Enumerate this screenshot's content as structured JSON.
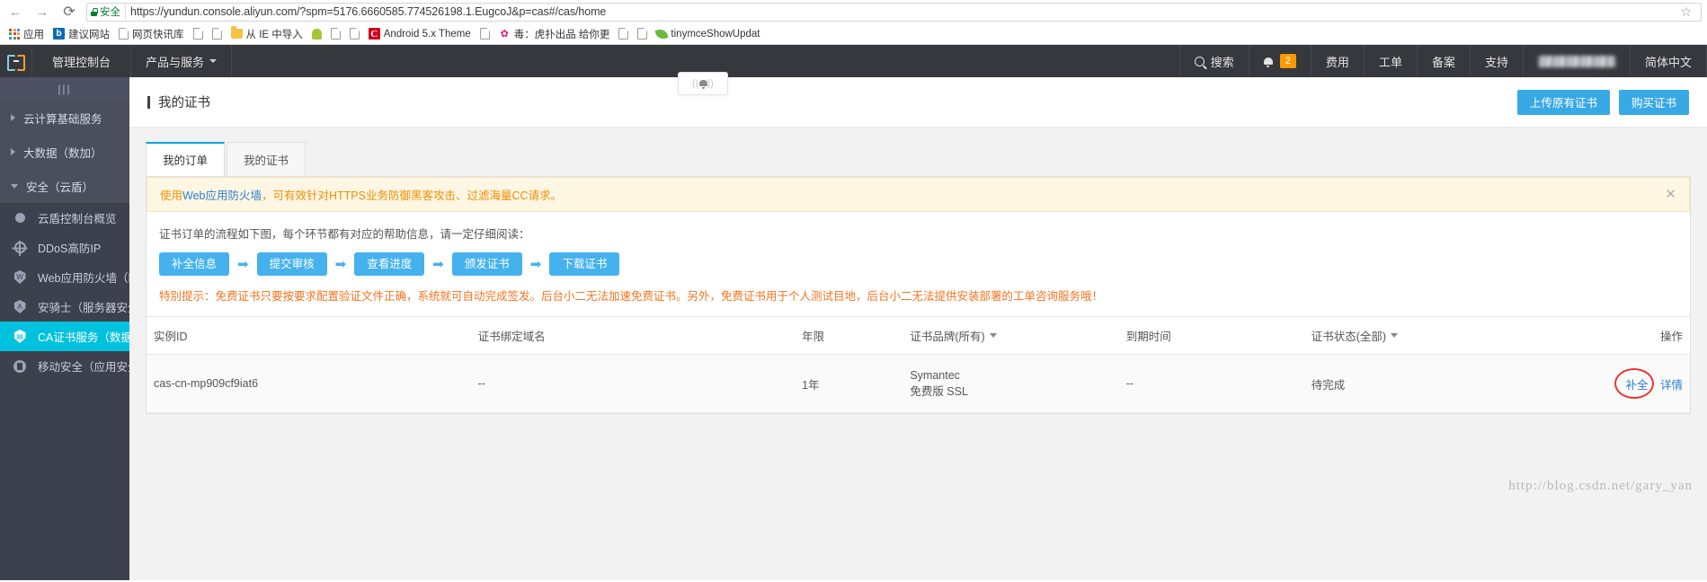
{
  "browser": {
    "back_icon": "←",
    "forward_icon": "→",
    "reload_icon": "⟳",
    "secure_label": "安全",
    "url": "https://yundun.console.aliyun.com/?spm=5176.6660585.774526198.1.EugcoJ&p=cas#/cas/home",
    "star_icon": "☆",
    "bookmarks": [
      {
        "label": "应用",
        "icon": "apps-grid-icon"
      },
      {
        "label": "建议网站",
        "icon": "bing-icon"
      },
      {
        "label": "网页快讯库",
        "icon": "page-icon"
      },
      {
        "label": "",
        "icon": "page-icon"
      },
      {
        "label": "",
        "icon": "page-icon"
      },
      {
        "label": "从 IE 中导入",
        "icon": "folder-icon"
      },
      {
        "label": "",
        "icon": "android-icon"
      },
      {
        "label": "",
        "icon": "page-icon"
      },
      {
        "label": "",
        "icon": "page-icon"
      },
      {
        "label": "Android 5.x Theme",
        "icon": "chrome-c-icon"
      },
      {
        "label": "",
        "icon": "page-icon"
      },
      {
        "label": "毒：虎扑出品 给你更",
        "icon": "hupu-icon"
      },
      {
        "label": "",
        "icon": "page-icon"
      },
      {
        "label": "",
        "icon": "page-icon"
      },
      {
        "label": "tinymceShowUpdat",
        "icon": "leaf-icon"
      }
    ]
  },
  "console_header": {
    "logo": "aliyun-logo-icon",
    "brand": "管理控制台",
    "products": "产品与服务",
    "right_items": [
      {
        "label": "搜索",
        "icon": "search-icon"
      },
      {
        "label": "",
        "icon": "bell-icon",
        "badge": "2"
      },
      {
        "label": "费用",
        "icon": ""
      },
      {
        "label": "工单",
        "icon": ""
      },
      {
        "label": "备案",
        "icon": ""
      },
      {
        "label": "支持",
        "icon": ""
      },
      {
        "label": "",
        "icon": "user-avatar-blurred"
      },
      {
        "label": "简体中文",
        "icon": ""
      }
    ]
  },
  "sidebar": {
    "handle_icon": "|||",
    "groups": [
      {
        "label": "云计算基础服务",
        "expanded": false
      },
      {
        "label": "大数据（数加）",
        "expanded": false
      },
      {
        "label": "安全（云盾）",
        "expanded": true
      }
    ],
    "items": [
      {
        "label": "云盾控制台概览",
        "icon": "dot-icon",
        "active": false
      },
      {
        "label": "DDoS高防IP",
        "icon": "gear-icon",
        "active": false
      },
      {
        "label": "Web应用防火墙（网...",
        "icon": "shield-web-icon",
        "active": false
      },
      {
        "label": "安骑士（服务器安全）",
        "icon": "shield-server-icon",
        "active": false
      },
      {
        "label": "CA证书服务（数据安...",
        "icon": "shield-ca-icon",
        "active": true
      },
      {
        "label": "移动安全（应用安全）",
        "icon": "mobile-security-icon",
        "active": false
      }
    ]
  },
  "page": {
    "title": "我的证书",
    "upload_button": "上传原有证书",
    "buy_button": "购买证书",
    "float_notice_icon": "((🔔))"
  },
  "tabs": [
    {
      "label": "我的订单",
      "active": true
    },
    {
      "label": "我的证书",
      "active": false
    }
  ],
  "notice": {
    "prefix": "使用",
    "link": "Web应用防火墙",
    "suffix": "，可有效针对HTTPS业务防御黑客攻击、过滤海量CC请求。",
    "close_icon": "✕"
  },
  "flow": {
    "description": "证书订单的流程如下图，每个环节都有对应的帮助信息，请一定仔细阅读：",
    "steps": [
      "补全信息",
      "提交审核",
      "查看进度",
      "颁发证书",
      "下载证书"
    ],
    "arrow_icon": "➡",
    "warning": "特别提示：免费证书只要按要求配置验证文件正确，系统就可自动完成签发。后台小二无法加速免费证书。另外，免费证书用于个人测试目地，后台小二无法提供安装部署的工单咨询服务哦！"
  },
  "table": {
    "columns": [
      {
        "label": "实例ID",
        "filter": false
      },
      {
        "label": "证书绑定域名",
        "filter": false
      },
      {
        "label": "年限",
        "filter": false
      },
      {
        "label": "证书品牌(所有)",
        "filter": true
      },
      {
        "label": "到期时间",
        "filter": false
      },
      {
        "label": "证书状态(全部)",
        "filter": true
      },
      {
        "label": "操作",
        "filter": false
      }
    ],
    "rows": [
      {
        "instance_id": "cas-cn-mp909cf9iat6",
        "domain": "--",
        "years": "1年",
        "brand_line1": "Symantec",
        "brand_line2": "免费版 SSL",
        "expire": "--",
        "status": "待完成",
        "action_primary": "补全",
        "action_secondary": "详情"
      }
    ]
  },
  "watermark": "http://blog.csdn.net/gary_yan",
  "colors": {
    "accent_cyan": "#00c1de",
    "header_dark": "#35383d",
    "sidebar": "#3d414d",
    "primary_blue": "#39a9e5",
    "step_blue": "#45b2ee",
    "warn_orange": "#f5741f",
    "badge_orange": "#ff9900",
    "link_blue": "#2f7fd1",
    "circle_red": "#e33333"
  }
}
